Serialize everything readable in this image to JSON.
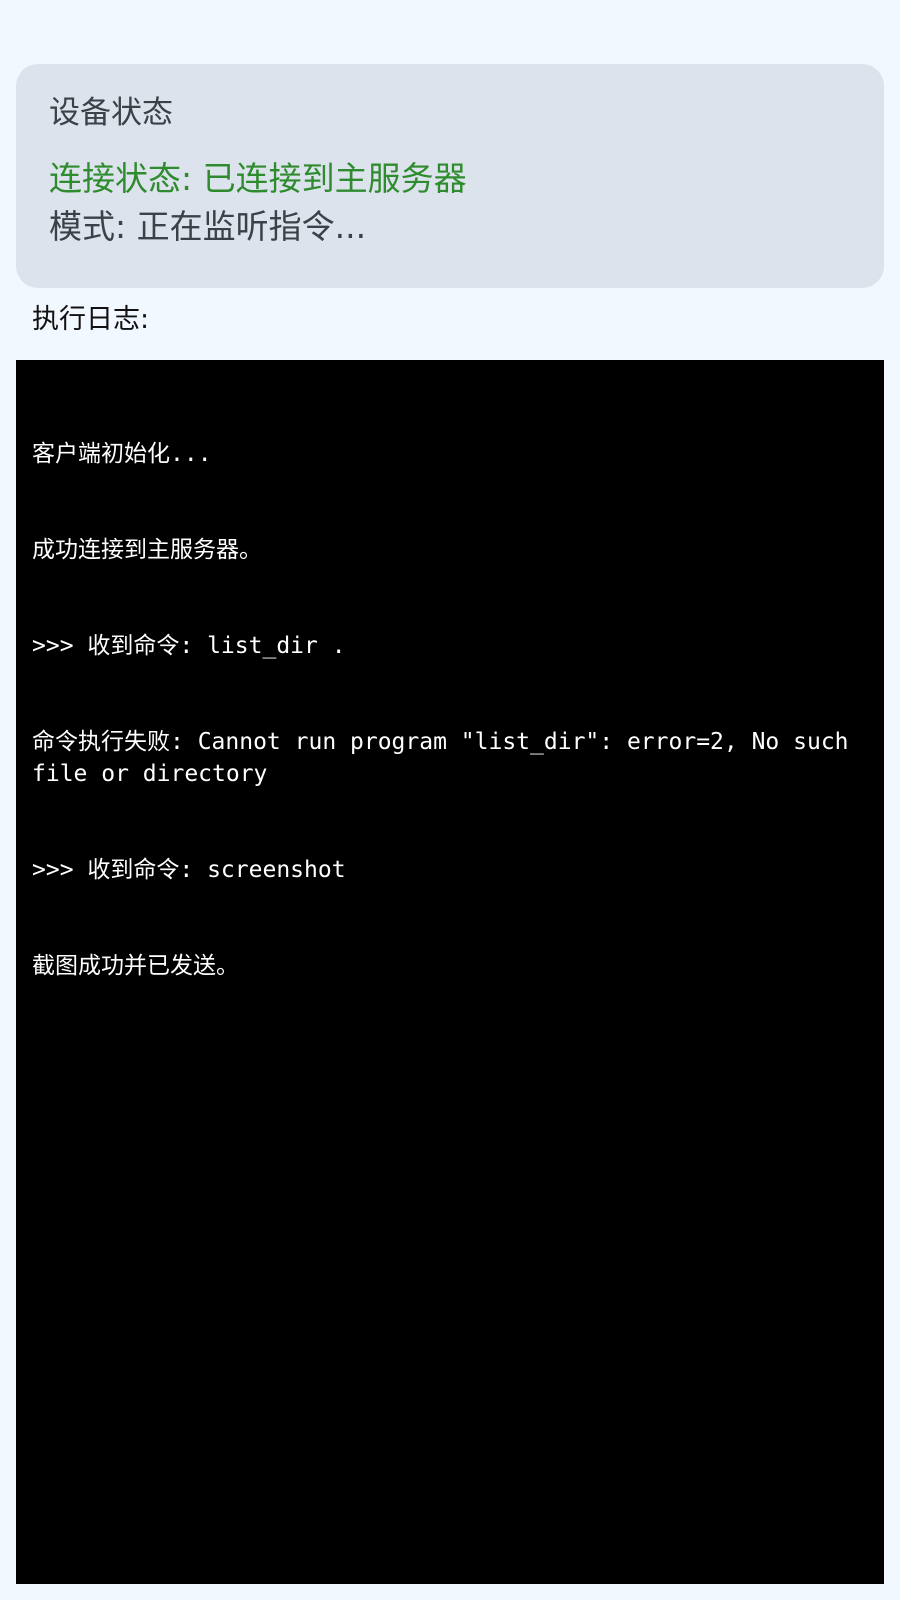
{
  "status_card": {
    "title": "设备状态",
    "connection": "连接状态: 已连接到主服务器",
    "mode": "模式: 正在监听指令...",
    "colors": {
      "connection": "#2e8b2e",
      "card_bg": "#dde3ec",
      "page_bg": "#f2f8ff"
    }
  },
  "log": {
    "label": "执行日志:",
    "lines": [
      "客户端初始化...",
      "成功连接到主服务器。",
      ">>> 收到命令: list_dir .",
      "命令执行失败: Cannot run program \"list_dir\": error=2, No such file or directory",
      ">>> 收到命令: screenshot",
      "截图成功并已发送。"
    ]
  }
}
